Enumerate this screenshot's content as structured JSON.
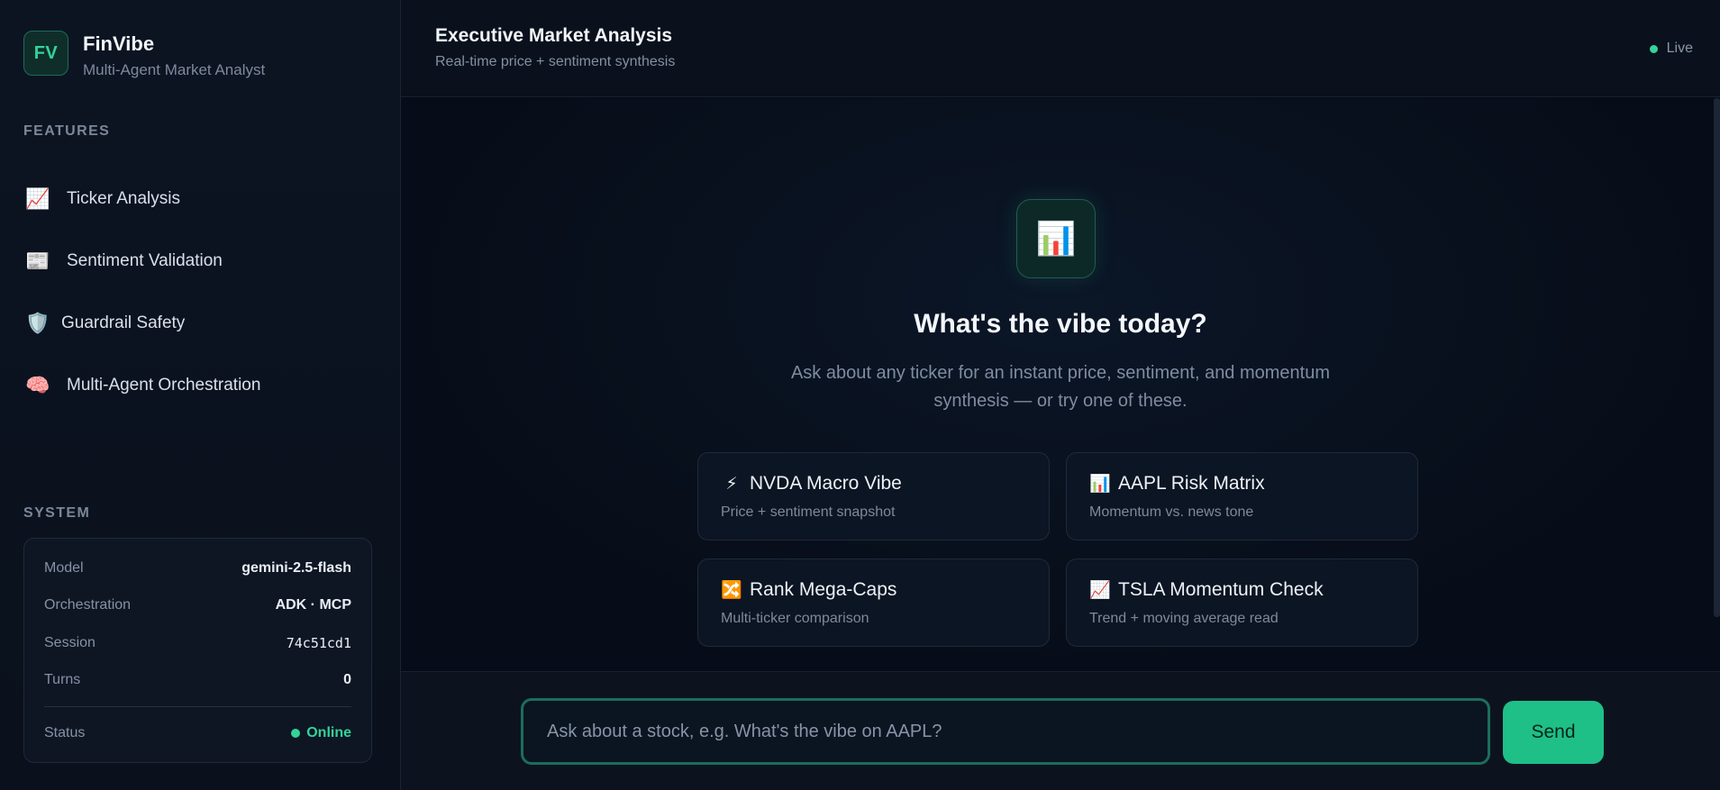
{
  "brand": {
    "logo_text": "FV",
    "name": "FinVibe",
    "subtitle": "Multi-Agent Market Analyst"
  },
  "sidebar": {
    "features_label": "FEATURES",
    "features": [
      {
        "icon": "chart-increasing-icon",
        "glyph": "📈",
        "label": "Ticker Analysis"
      },
      {
        "icon": "newspaper-icon",
        "glyph": "📰",
        "label": "Sentiment Validation"
      },
      {
        "icon": "shield-icon",
        "glyph": "🛡️",
        "label": "Guardrail Safety"
      },
      {
        "icon": "brain-icon",
        "glyph": "🧠",
        "label": "Multi-Agent Orchestration"
      }
    ],
    "system_label": "SYSTEM",
    "system": {
      "model_key": "Model",
      "model_value": "gemini-2.5-flash",
      "orchestration_key": "Orchestration",
      "orchestration_value": "ADK · MCP",
      "session_key": "Session",
      "session_value": "74c51cd1",
      "turns_key": "Turns",
      "turns_value": "0",
      "status_key": "Status",
      "status_value": "Online"
    }
  },
  "header": {
    "title": "Executive Market Analysis",
    "subtitle": "Real-time price + sentiment synthesis",
    "live_label": "Live"
  },
  "hero": {
    "icon": "bar-chart-icon",
    "glyph": "📊",
    "title": "What's the vibe today?",
    "subtitle": "Ask about any ticker for an instant price, sentiment, and momentum synthesis — or try one of these."
  },
  "suggestions": [
    {
      "icon": "lightning-icon",
      "glyph": "⚡",
      "title": "NVDA Macro Vibe",
      "subtitle": "Price + sentiment snapshot"
    },
    {
      "icon": "bar-chart-icon",
      "glyph": "📊",
      "title": "AAPL Risk Matrix",
      "subtitle": "Momentum vs. news tone"
    },
    {
      "icon": "shuffle-icon",
      "glyph": "🔀",
      "title": "Rank Mega-Caps",
      "subtitle": "Multi-ticker comparison"
    },
    {
      "icon": "chart-increasing-icon",
      "glyph": "📈",
      "title": "TSLA Momentum Check",
      "subtitle": "Trend + moving average read"
    }
  ],
  "composer": {
    "placeholder": "Ask about a stock, e.g. What's the vibe on AAPL?",
    "value": "",
    "send_label": "Send"
  },
  "colors": {
    "accent": "#34d399",
    "send_button": "#1fbf88",
    "background": "#070c16"
  }
}
